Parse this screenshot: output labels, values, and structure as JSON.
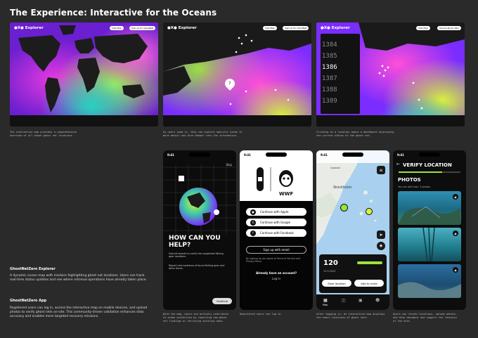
{
  "page": {
    "title": "The Experience: Interactive for the Oceans"
  },
  "colors": {
    "background": "#2a2a2a",
    "accent_green": "#9be33c",
    "accent_magenta": "#e03ad1",
    "accent_purple": "#7b2cff"
  },
  "web_shots": [
    {
      "brand": "●X● Explorer",
      "pills": [
        "Visit Map",
        "Sign up for GhostNet"
      ],
      "caption": [
        "The interactive map provides a comprehensive",
        "overview of all known ghost net locations."
      ]
    },
    {
      "brand": "●X● Explorer",
      "pills": [
        "Visit Map",
        "Sign up for GhostNet"
      ],
      "marker": "7",
      "caption": [
        "As users zoom in, they can explore specific areas in",
        "more detail and dive deeper into the information."
      ]
    },
    {
      "brand": "●X● Explorer",
      "pills": [
        "Visit Map",
        "Upload ghost data"
      ],
      "years": [
        "1384",
        "1385",
        "1386",
        "1387",
        "1388",
        "1389"
      ],
      "caption": [
        "Clicking on a location opens a dashboard displaying",
        "the current status of the ghost net."
      ]
    }
  ],
  "left_text": {
    "explorer_heading": "GhostNetZero Explorer",
    "explorer_body": "A dynamic ocean map with markers highlighting ghost net locations. Users can track real-time status updates and see where retrieval operations have already taken place.",
    "app_heading": "GhostNetZero App",
    "app_body": "Registered users can log in, access the interactive map on mobile devices, and upload photos to verify ghost nets on-site. This community-driven validation enhances data accuracy and enables more targeted recovery missions."
  },
  "phone1": {
    "time": "9:41",
    "skip": "Skip",
    "heading": "HOW CAN YOU HELP?",
    "text1": "Submit reports to verify the suspected fishing gear locations.",
    "text2": "Report new locations of found fishing gear and other items.",
    "continue": "Continue",
    "caption": [
      "With the map, users can actively contribute",
      "to ocean protection by reporting new ghost",
      "net findings or verifying existing ones."
    ]
  },
  "phone2": {
    "time": "9:41",
    "brand": "WWF",
    "apple": "Continue with Apple",
    "google": "Continue with Google",
    "facebook": "Continue with Facebook",
    "email": "Sign up with email",
    "terms": "By signing up you agree to Terms of Service and Privacy Policy.",
    "have_account": "Already have an account?",
    "login": "Log in",
    "caption": [
      "Registered users can log in."
    ]
  },
  "phone3": {
    "time": "9:41",
    "city1": "Uppsala",
    "city2": "Stockholm",
    "count": "120",
    "date": "12.3.2023",
    "save": "Save location",
    "add_route": "Add to route",
    "nav": [
      "Map",
      "",
      "",
      ""
    ],
    "caption": [
      "After logging in, an interactive map displays",
      "the exact locations of ghost nets."
    ]
  },
  "phone4": {
    "time": "9:41",
    "heading": "VERIFY LOCATION",
    "photos_label": "PHOTOS",
    "photos_sub": "You can add max. 3 photos.",
    "caption": [
      "Users can review locations, upload photos,",
      "and help document and support the recovery",
      "of the nets."
    ]
  }
}
